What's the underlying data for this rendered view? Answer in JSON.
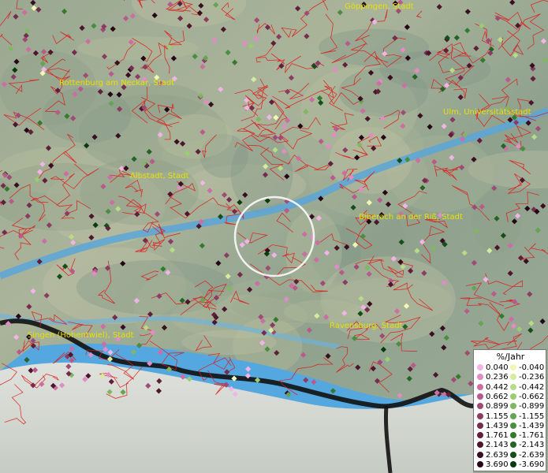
{
  "map": {
    "cities": [
      {
        "name": "Göppingen, Stadt"
      },
      {
        "name": "Rottenburg am Neckar, Stadt"
      },
      {
        "name": "Ulm, Universitätsstadt"
      },
      {
        "name": "Albstadt, Stadt"
      },
      {
        "name": "Biberach an der Riß, Stadt"
      },
      {
        "name": "Ravensburg, Stadt"
      },
      {
        "name": "Singen (Hohentwiel), Stadt"
      }
    ]
  },
  "legend": {
    "title": "%/Jahr",
    "positive": [
      {
        "value": "0.040",
        "color": "#f0b4e6"
      },
      {
        "value": "0.236",
        "color": "#e08cc6"
      },
      {
        "value": "0.442",
        "color": "#cc6ea4"
      },
      {
        "value": "0.662",
        "color": "#b85a8c"
      },
      {
        "value": "0.899",
        "color": "#a04a76"
      },
      {
        "value": "1.155",
        "color": "#8c3c62"
      },
      {
        "value": "1.439",
        "color": "#762c4e"
      },
      {
        "value": "1.761",
        "color": "#60203c"
      },
      {
        "value": "2.143",
        "color": "#4c162e"
      },
      {
        "value": "2.639",
        "color": "#380e20"
      },
      {
        "value": "3.690",
        "color": "#240616"
      }
    ],
    "negative": [
      {
        "value": "-0.040",
        "color": "#f0f8b4"
      },
      {
        "value": "-0.236",
        "color": "#d6ec9c"
      },
      {
        "value": "-0.442",
        "color": "#b8dc86"
      },
      {
        "value": "-0.662",
        "color": "#9ccc72"
      },
      {
        "value": "-0.899",
        "color": "#80b862"
      },
      {
        "value": "-1.155",
        "color": "#64a452"
      },
      {
        "value": "-1.439",
        "color": "#4a8e40"
      },
      {
        "value": "-1.761",
        "color": "#367a30"
      },
      {
        "value": "-2.143",
        "color": "#246424"
      },
      {
        "value": "-2.639",
        "color": "#144e18"
      },
      {
        "value": "-3.690",
        "color": "#083a0e"
      }
    ]
  }
}
